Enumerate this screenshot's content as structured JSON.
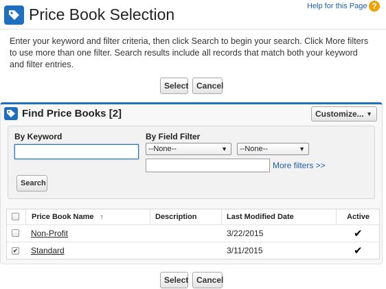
{
  "header": {
    "icon": "price-tag-icon",
    "title": "Price Book Selection",
    "help_link": "Help for this Page",
    "help_icon": "?"
  },
  "instructions": "Enter your keyword and filter criteria, then click Search to begin your search. Click More filters to use more than one filter. Search results include all records that match both your keyword and filter entries.",
  "buttons": {
    "select": "Select",
    "cancel": "Cancel"
  },
  "panel": {
    "icon": "price-book-icon",
    "title": "Find Price Books [2]",
    "customize": "Customize...",
    "customize_caret": "▼",
    "accent_color": "#1f6fbf"
  },
  "search": {
    "keyword_label": "By Keyword",
    "keyword_value": "",
    "field_filter_label": "By Field Filter",
    "field_select_value": "--None--",
    "operator_select_value": "--None--",
    "select_caret": "▼",
    "filter_value": "",
    "more_filters": "More filters >>",
    "search_button": "Search"
  },
  "table": {
    "columns": [
      "Price Book Name",
      "Description",
      "Last Modified Date",
      "Active"
    ],
    "sort_indicator": "↑",
    "rows": [
      {
        "selected": false,
        "name": "Non-Profit",
        "description": "",
        "last_modified": "3/22/2015",
        "active": "✔"
      },
      {
        "selected": true,
        "name": "Standard",
        "description": "",
        "last_modified": "3/11/2015",
        "active": "✔"
      }
    ]
  },
  "checkmark": "✔"
}
